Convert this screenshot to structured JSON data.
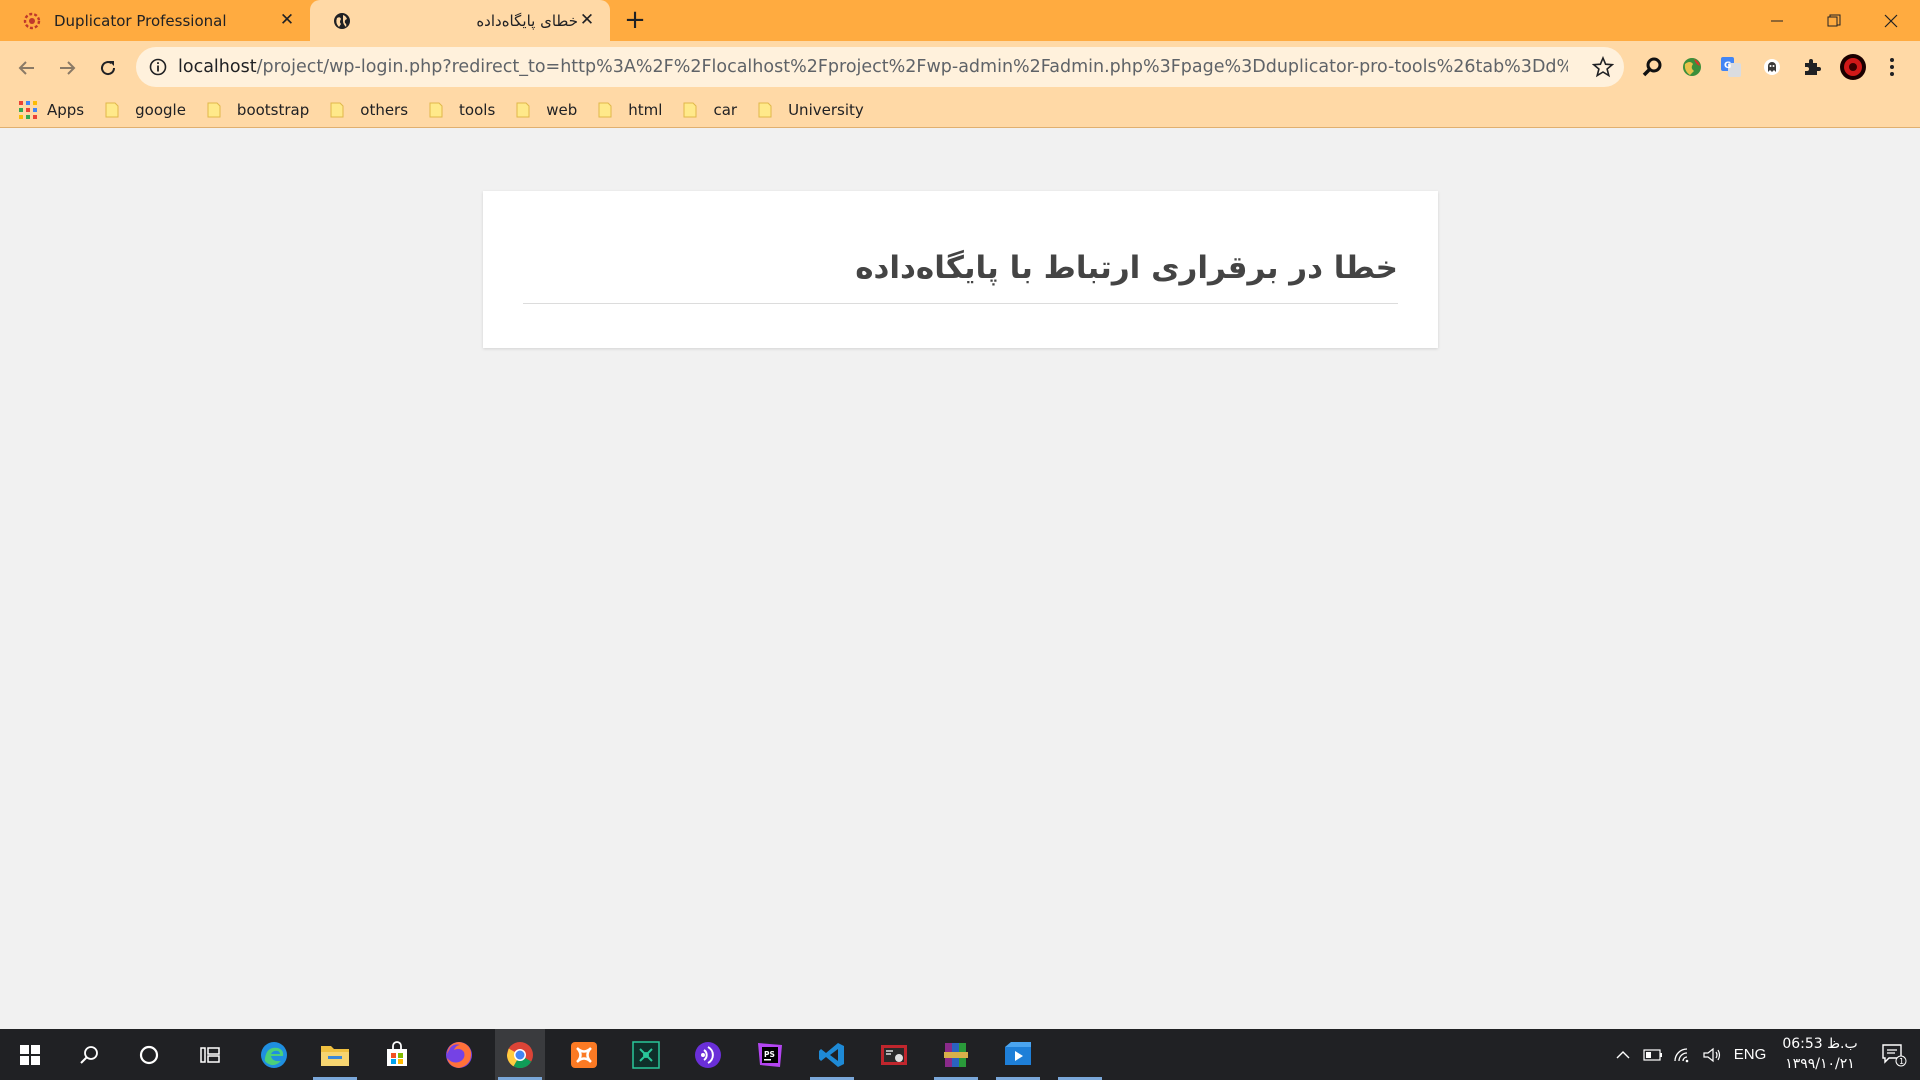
{
  "browser": {
    "tabs": [
      {
        "title": "Duplicator Professional",
        "active": false,
        "favicon": "duplicator-icon"
      },
      {
        "title": "خطای پایگاه‌داده",
        "active": true,
        "favicon": "globe-icon"
      }
    ],
    "url_host": "localhost",
    "url_rest": "/project/wp-login.php?redirect_to=http%3A%2F%2Flocalhost%2Fproject%2Fwp-admin%2Fadmin.php%3Fpage%3Dduplicator-pro-tools%26tab%3Dd%26in%3Dinstaller.p...",
    "bookmarks": [
      {
        "label": "Apps",
        "icon": "apps-grid-icon"
      },
      {
        "label": "google",
        "icon": "folder-icon"
      },
      {
        "label": "bootstrap",
        "icon": "folder-icon"
      },
      {
        "label": "others",
        "icon": "folder-icon"
      },
      {
        "label": "tools",
        "icon": "folder-icon"
      },
      {
        "label": "web",
        "icon": "folder-icon"
      },
      {
        "label": "html",
        "icon": "folder-icon"
      },
      {
        "label": "car",
        "icon": "folder-icon"
      },
      {
        "label": "University",
        "icon": "folder-icon"
      }
    ]
  },
  "page": {
    "error_title": "خطا در برقراری ارتباط با پایگاه‌داده"
  },
  "taskbar": {
    "language": "ENG",
    "time": "06:53 ب.ظ",
    "date": "۱۳۹۹/۱۰/۲۱",
    "notification_count": "1"
  },
  "colors": {
    "tabstrip": "#ffab40",
    "toolbar": "#ffd9a6",
    "page_bg": "#f1f1f1",
    "taskbar": "#202124"
  }
}
